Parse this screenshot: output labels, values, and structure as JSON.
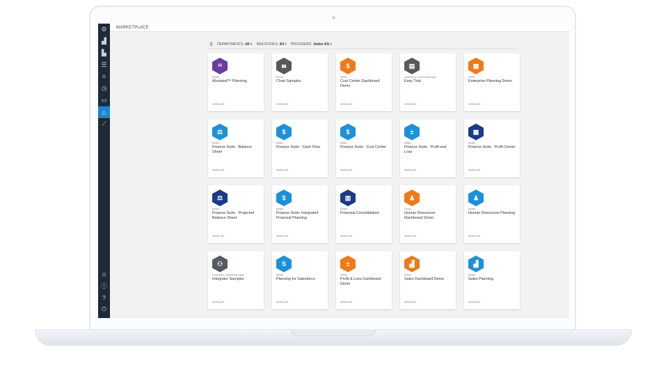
{
  "header": {
    "title": "MARKETPLACE"
  },
  "filters": {
    "departments_label": "DEPARTMENTS:",
    "departments_value": "All",
    "industries_label": "INDUSTRIES:",
    "industries_value": "All",
    "providers_label": "PROVIDERS:",
    "providers_value": "Jedox AG"
  },
  "sidebar": {
    "items": [
      {
        "icon": "settings-icon",
        "glyph": "⚙"
      },
      {
        "icon": "analytics-icon",
        "glyph": "▟"
      },
      {
        "icon": "reports-icon",
        "glyph": "▙"
      },
      {
        "icon": "database-icon",
        "glyph": "☰"
      },
      {
        "icon": "modeler-icon",
        "glyph": "⌗"
      },
      {
        "icon": "timer-icon",
        "glyph": "◷"
      },
      {
        "icon": "integrator-icon",
        "glyph": "▭"
      },
      {
        "icon": "marketplace-icon",
        "glyph": "⌂",
        "active": true
      },
      {
        "icon": "tools-icon",
        "glyph": "⟋"
      }
    ],
    "bottom": [
      {
        "icon": "user-icon",
        "glyph": "☺"
      },
      {
        "icon": "info-icon",
        "glyph": "ⓘ"
      },
      {
        "icon": "help-icon",
        "glyph": "?"
      },
      {
        "icon": "power-icon",
        "glyph": "⏻"
      }
    ]
  },
  "colors": {
    "purple": "#6a3d9e",
    "grey": "#555a5f",
    "orange": "#f07a1a",
    "blue": "#1e90d8",
    "navy": "#1d3a86",
    "accent": "#1b86d6"
  },
  "cards": [
    {
      "category": "Model",
      "title": "AIssisted™ Planning",
      "provider": "Jedox AG",
      "color": "purple",
      "glyph": "AI"
    },
    {
      "category": "Demo",
      "title": "Chart Samples",
      "provider": "Jedox AG",
      "color": "grey",
      "glyph": "▮▮"
    },
    {
      "category": "Demo",
      "title": "Cost Center Dashboard Demo",
      "provider": "Jedox AG",
      "color": "orange",
      "glyph": "$"
    },
    {
      "category": "Learning & Community Apps",
      "title": "Easy Trial",
      "provider": "Jedox AG",
      "color": "grey",
      "glyph": "▤"
    },
    {
      "category": "Demo",
      "title": "Enterprise Planning Demo",
      "provider": "Jedox AG",
      "color": "orange",
      "glyph": "▦"
    },
    {
      "category": "Model",
      "title": "Finance Suite : Balance Sheet",
      "provider": "Jedox AG",
      "color": "blue",
      "glyph": "⚖"
    },
    {
      "category": "Model",
      "title": "Finance Suite : Cash Flow",
      "provider": "Jedox AG",
      "color": "blue",
      "glyph": "$"
    },
    {
      "category": "Model",
      "title": "Finance Suite : Cost Center",
      "provider": "Jedox AG",
      "color": "blue",
      "glyph": "$"
    },
    {
      "category": "Model",
      "title": "Finance Suite : Profit and Loss",
      "provider": "Jedox AG",
      "color": "blue",
      "glyph": "±"
    },
    {
      "category": "Model",
      "title": "Finance Suite : Profit Center",
      "provider": "Jedox AG",
      "color": "navy",
      "glyph": "▦"
    },
    {
      "category": "Model",
      "title": "Finance Suite : Projected Balance Sheet",
      "provider": "Jedox AG",
      "color": "navy",
      "glyph": "⚖"
    },
    {
      "category": "Model",
      "title": "Finance Suite: Integrated Financial Planning",
      "provider": "Jedox AG",
      "color": "blue",
      "glyph": "$"
    },
    {
      "category": "Model",
      "title": "Financial Consolidation",
      "provider": "Jedox AG",
      "color": "navy",
      "glyph": "▥"
    },
    {
      "category": "Demo",
      "title": "Human Resources Dashboard Demo",
      "provider": "Jedox AG",
      "color": "orange",
      "glyph": "♟"
    },
    {
      "category": "Model",
      "title": "Human Resources Planning",
      "provider": "Jedox AG",
      "color": "blue",
      "glyph": "♟"
    },
    {
      "category": "Learning & Community Apps",
      "title": "Integrator Samples",
      "provider": "Jedox AG",
      "color": "grey",
      "glyph": "⚇"
    },
    {
      "category": "Model",
      "title": "Planning for Salesforce",
      "provider": "Jedox AG",
      "color": "blue",
      "glyph": "S"
    },
    {
      "category": "Demo",
      "title": "Profit & Loss Dashboard Demo",
      "provider": "Jedox AG",
      "color": "orange",
      "glyph": "±"
    },
    {
      "category": "Demo",
      "title": "Sales Dashboard Demo",
      "provider": "Jedox AG",
      "color": "orange",
      "glyph": "▟"
    },
    {
      "category": "Model",
      "title": "Sales Planning",
      "provider": "Jedox AG",
      "color": "blue",
      "glyph": "▟"
    }
  ]
}
